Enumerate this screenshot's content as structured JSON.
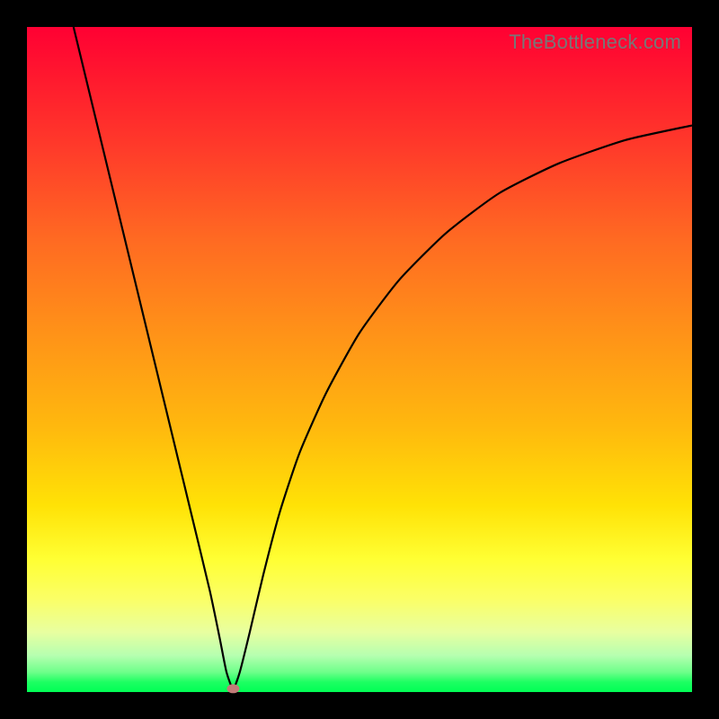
{
  "watermark": "TheBottleneck.com",
  "chart_data": {
    "type": "line",
    "title": "",
    "xlabel": "",
    "ylabel": "",
    "xlim": [
      0,
      1
    ],
    "ylim": [
      0,
      1
    ],
    "gradient": {
      "top": "#ff0033",
      "bottom": "#00ff55"
    },
    "curve_description": "V-shaped bottleneck curve. Left branch descends steeply and nearly straight from top-left toward a minimum near x≈0.31, y≈0.005. Right branch rises with decreasing slope toward the upper right, ending near y≈0.85 at x=1.",
    "min_point": {
      "x": 0.31,
      "y": 0.005
    },
    "series": [
      {
        "name": "bottleneck-curve",
        "points": [
          {
            "x": 0.07,
            "y": 1.0
          },
          {
            "x": 0.1,
            "y": 0.876
          },
          {
            "x": 0.13,
            "y": 0.752
          },
          {
            "x": 0.16,
            "y": 0.628
          },
          {
            "x": 0.19,
            "y": 0.504
          },
          {
            "x": 0.22,
            "y": 0.38
          },
          {
            "x": 0.25,
            "y": 0.256
          },
          {
            "x": 0.275,
            "y": 0.152
          },
          {
            "x": 0.29,
            "y": 0.08
          },
          {
            "x": 0.3,
            "y": 0.03
          },
          {
            "x": 0.31,
            "y": 0.005
          },
          {
            "x": 0.32,
            "y": 0.03
          },
          {
            "x": 0.335,
            "y": 0.09
          },
          {
            "x": 0.355,
            "y": 0.175
          },
          {
            "x": 0.38,
            "y": 0.27
          },
          {
            "x": 0.41,
            "y": 0.36
          },
          {
            "x": 0.45,
            "y": 0.45
          },
          {
            "x": 0.5,
            "y": 0.54
          },
          {
            "x": 0.56,
            "y": 0.62
          },
          {
            "x": 0.63,
            "y": 0.69
          },
          {
            "x": 0.71,
            "y": 0.75
          },
          {
            "x": 0.8,
            "y": 0.795
          },
          {
            "x": 0.9,
            "y": 0.83
          },
          {
            "x": 1.0,
            "y": 0.852
          }
        ]
      }
    ]
  }
}
